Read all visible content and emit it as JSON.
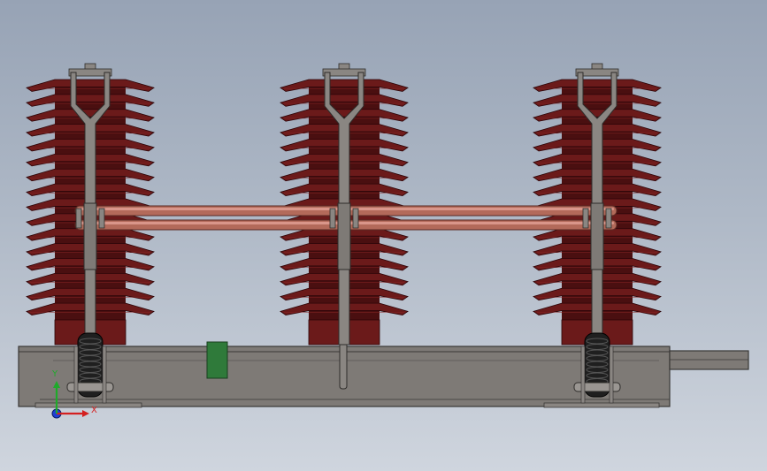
{
  "scene": {
    "description_visible": false,
    "colors": {
      "background_top": "#97a3b5",
      "background_bottom": "#cfd5de",
      "insulator": "#6b1a1a",
      "insulator_dark": "#4a0f10",
      "insulator_edge": "#2b0508",
      "busbar": "#b36a5a",
      "busbar_highlight": "#d9968a",
      "frame": "#7e7a76",
      "frame_edge": "#3a3836",
      "arm": "#8a8682",
      "spring": "#1f1f1f",
      "green_block": "#2f7a3a"
    }
  },
  "insulators": [
    {
      "name": "left",
      "sheds": 16
    },
    {
      "name": "center",
      "sheds": 16
    },
    {
      "name": "right",
      "sheds": 16
    }
  ],
  "triad": {
    "x_label": "X",
    "y_label": "Y",
    "x_color": "#d42020",
    "y_color": "#1faa2a",
    "z_color": "#1f3fd4"
  }
}
